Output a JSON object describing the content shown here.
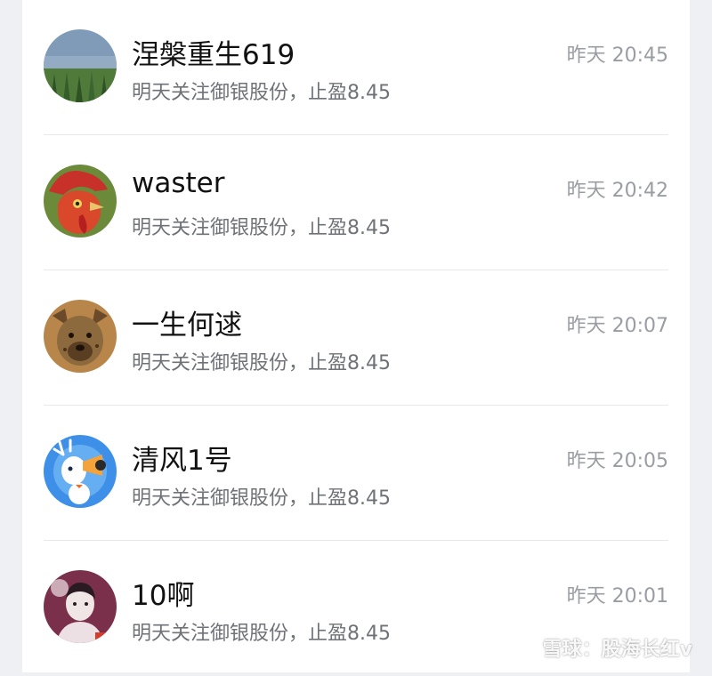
{
  "messages": [
    {
      "name": "涅槃重生619",
      "preview": "明天关注御银股份，止盈8.45",
      "time": "昨天 20:45",
      "avatar_icon": "landscape-field-avatar"
    },
    {
      "name": "waster",
      "preview": "明天关注御银股份，止盈8.45",
      "time": "昨天 20:42",
      "avatar_icon": "rooster-avatar"
    },
    {
      "name": "一生何逑",
      "preview": "明天关注御银股份，止盈8.45",
      "time": "昨天 20:07",
      "avatar_icon": "hyena-avatar"
    },
    {
      "name": "清风1号",
      "preview": "明天关注御银股份，止盈8.45",
      "time": "昨天 20:05",
      "avatar_icon": "cartoon-deer-avatar"
    },
    {
      "name": "10啊",
      "preview": "明天关注御银股份，止盈8.45",
      "time": "昨天 20:01",
      "avatar_icon": "person-photo-avatar"
    }
  ],
  "watermark": "雪球：股海长红v"
}
